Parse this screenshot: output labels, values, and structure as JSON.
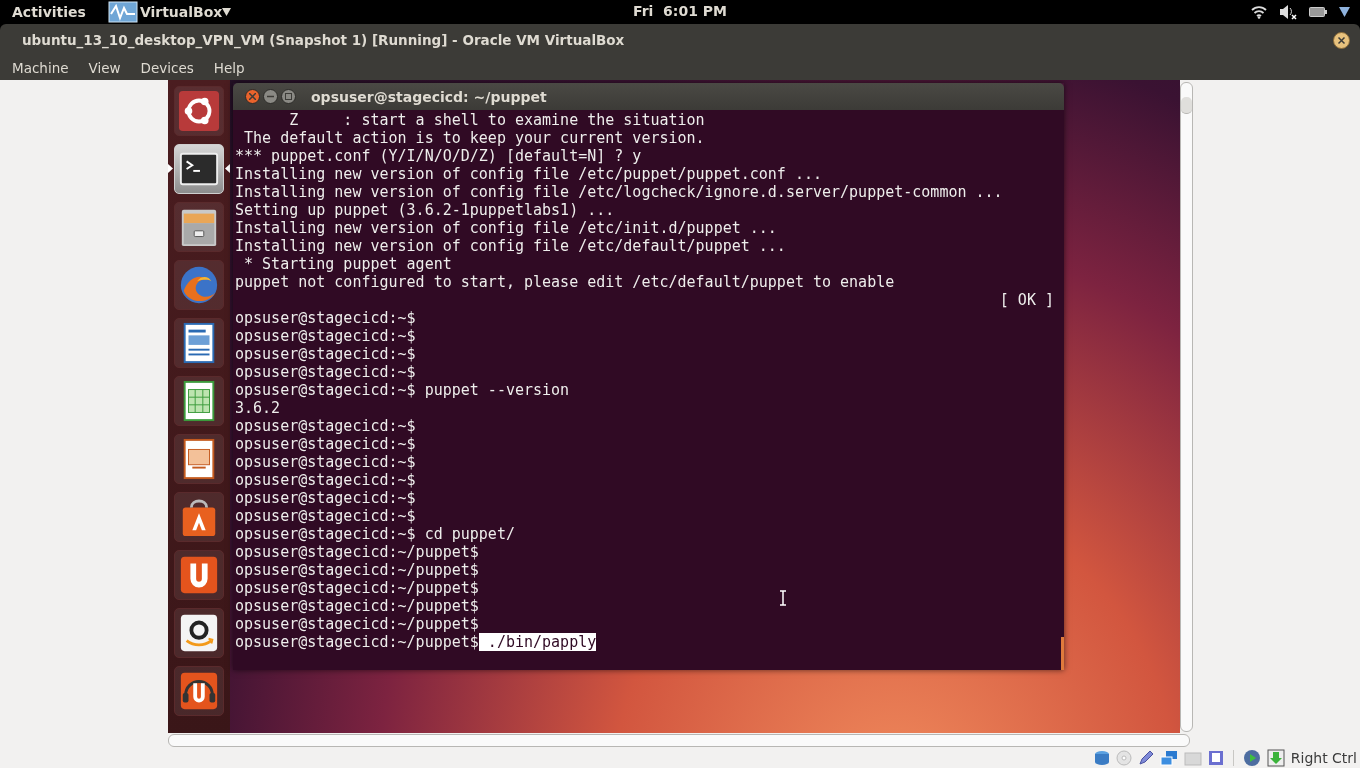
{
  "top_panel": {
    "activities": "Activities",
    "app_menu": "VirtualBox",
    "clock": "Fri  6:01 PM"
  },
  "window": {
    "title": "ubuntu_13_10_desktop_VPN_VM (Snapshot 1) [Running] - Oracle VM VirtualBox",
    "menu": [
      "Machine",
      "View",
      "Devices",
      "Help"
    ]
  },
  "launcher": [
    {
      "kind": "dash",
      "selected": false
    },
    {
      "kind": "terminal",
      "selected": true
    },
    {
      "kind": "files",
      "selected": false
    },
    {
      "kind": "browser",
      "selected": false
    },
    {
      "kind": "writer",
      "selected": false
    },
    {
      "kind": "calc",
      "selected": false
    },
    {
      "kind": "impress",
      "selected": false
    },
    {
      "kind": "software",
      "selected": false
    },
    {
      "kind": "cloud",
      "selected": false
    },
    {
      "kind": "shop",
      "selected": false
    },
    {
      "kind": "music",
      "selected": false
    }
  ],
  "terminal": {
    "title": "opsuser@stagecicd: ~/puppet",
    "lines": [
      {
        "kind": "output",
        "text": "      Z     : start a shell to examine the situation"
      },
      {
        "kind": "output",
        "text": " The default action is to keep your current version."
      },
      {
        "kind": "output",
        "text": "*** puppet.conf (Y/I/N/O/D/Z) [default=N] ? y"
      },
      {
        "kind": "output",
        "text": "Installing new version of config file /etc/puppet/puppet.conf ..."
      },
      {
        "kind": "output",
        "text": "Installing new version of config file /etc/logcheck/ignore.d.server/puppet-common ..."
      },
      {
        "kind": "output",
        "text": "Setting up puppet (3.6.2-1puppetlabs1) ..."
      },
      {
        "kind": "output",
        "text": "Installing new version of config file /etc/init.d/puppet ..."
      },
      {
        "kind": "output",
        "text": "Installing new version of config file /etc/default/puppet ..."
      },
      {
        "kind": "output",
        "text": " * Starting puppet agent"
      },
      {
        "kind": "output",
        "text": "puppet not configured to start, please edit /etc/default/puppet to enable"
      },
      {
        "kind": "status",
        "text": "[ OK ]"
      },
      {
        "kind": "output",
        "text": "opsuser@stagecicd:~$"
      },
      {
        "kind": "output",
        "text": "opsuser@stagecicd:~$"
      },
      {
        "kind": "output",
        "text": "opsuser@stagecicd:~$"
      },
      {
        "kind": "output",
        "text": "opsuser@stagecicd:~$"
      },
      {
        "kind": "output",
        "text": "opsuser@stagecicd:~$ puppet --version"
      },
      {
        "kind": "output",
        "text": "3.6.2"
      },
      {
        "kind": "output",
        "text": "opsuser@stagecicd:~$"
      },
      {
        "kind": "output",
        "text": "opsuser@stagecicd:~$"
      },
      {
        "kind": "output",
        "text": "opsuser@stagecicd:~$"
      },
      {
        "kind": "output",
        "text": "opsuser@stagecicd:~$"
      },
      {
        "kind": "output",
        "text": "opsuser@stagecicd:~$"
      },
      {
        "kind": "output",
        "text": "opsuser@stagecicd:~$"
      },
      {
        "kind": "output",
        "text": "opsuser@stagecicd:~$ cd puppet/"
      },
      {
        "kind": "output",
        "text": "opsuser@stagecicd:~/puppet$"
      },
      {
        "kind": "output",
        "text": "opsuser@stagecicd:~/puppet$"
      },
      {
        "kind": "output",
        "text": "opsuser@stagecicd:~/puppet$"
      },
      {
        "kind": "output",
        "text": "opsuser@stagecicd:~/puppet$"
      },
      {
        "kind": "output",
        "text": "opsuser@stagecicd:~/puppet$"
      },
      {
        "kind": "input",
        "text": "opsuser@stagecicd:~/puppet$",
        "selection": " ./bin/papply"
      }
    ]
  },
  "status_bar": {
    "host_key": "Right Ctrl"
  }
}
